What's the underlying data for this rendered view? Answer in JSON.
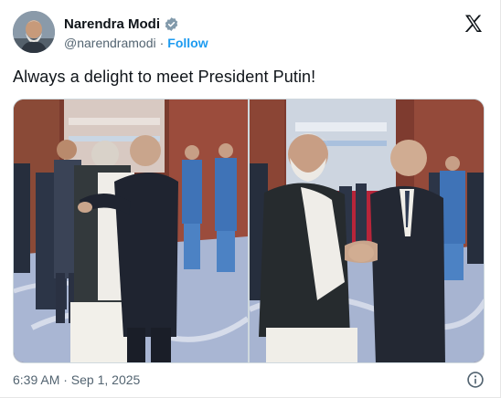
{
  "post": {
    "author_name": "Narendra Modi",
    "handle": "@narendramodi",
    "separator": "·",
    "follow_label": "Follow",
    "text": "Always a delight to meet President Putin!",
    "timestamp": "6:39 AM · Sep 1, 2025"
  },
  "icons": {
    "verified": "verified-badge-icon",
    "brand": "x-logo-icon",
    "info": "info-icon"
  },
  "colors": {
    "accent": "#1d9bf0",
    "secondary_text": "#536471",
    "primary_text": "#0f1419"
  },
  "media": {
    "count": 2
  }
}
